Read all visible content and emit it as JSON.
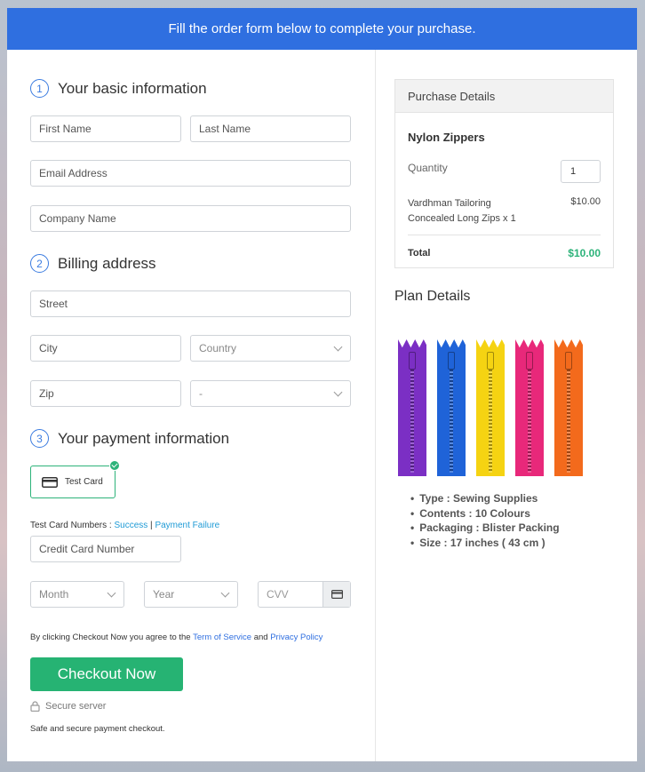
{
  "banner": {
    "text": "Fill the order form below to complete your purchase."
  },
  "basic": {
    "step": "1",
    "title": "Your basic information",
    "first_name": "First Name",
    "last_name": "Last Name",
    "email": "Email Address",
    "company": "Company Name"
  },
  "billing": {
    "step": "2",
    "title": "Billing address",
    "street": "Street",
    "city": "City",
    "country": "Country",
    "zip": "Zip",
    "state": "-"
  },
  "payment": {
    "step": "3",
    "title": "Your payment information",
    "card_option": "Test Card",
    "test_numbers_label": "Test Card Numbers : ",
    "success_link": "Success",
    "separator": " | ",
    "failure_link": "Payment Failure",
    "card_number": "Credit Card Number",
    "month": "Month",
    "year": "Year",
    "cvv": "CVV"
  },
  "terms": {
    "prefix": "By clicking Checkout Now you agree to the ",
    "terms_link": "Term of Service",
    "and": " and ",
    "privacy_link": "Privacy Policy"
  },
  "checkout": {
    "button": "Checkout Now",
    "secure": "Secure server",
    "footer": "Safe and secure payment checkout."
  },
  "purchase": {
    "header": "Purchase Details",
    "product": "Nylon Zippers",
    "quantity_label": "Quantity",
    "quantity_value": "1",
    "item_line1": "Vardhman Tailoring",
    "item_line2": "Concealed Long Zips x 1",
    "item_price": "$10.00",
    "total_label": "Total",
    "total_value": "$10.00",
    "total_color": "#2db37a"
  },
  "plan": {
    "title": "Plan Details",
    "zipper_colors": [
      "#7b2fc4",
      "#1f63d8",
      "#f5d312",
      "#e8287a",
      "#f36a1c"
    ],
    "features": [
      "Type : Sewing Supplies",
      "Contents : 10 Colours",
      "Packaging : Blister Packing",
      "Size : 17 inches ( 43 cm )"
    ]
  },
  "colors": {
    "accent": "#2f6fe0",
    "success": "#26b373"
  }
}
